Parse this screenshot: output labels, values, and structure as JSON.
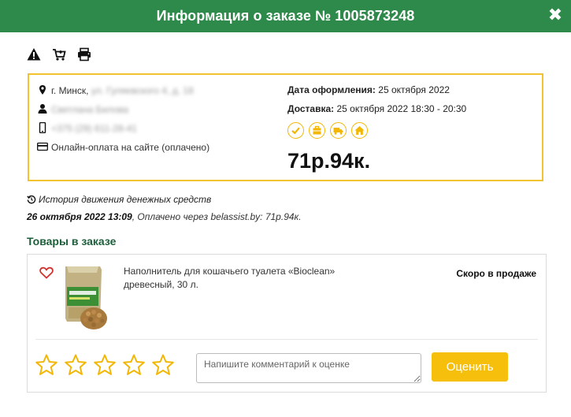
{
  "header": {
    "title": "Информация о заказе № 1005873248",
    "close_icon": "close-icon"
  },
  "toolbar": {
    "icons": [
      "warning-icon",
      "cart-icon",
      "print-icon"
    ]
  },
  "order": {
    "city": "г. Минск,",
    "street": "ул. Гуляевского 4, д. 18",
    "customer_name": "Светлана Билова",
    "phone": "+375 (29) 611-28-41",
    "payment": "Онлайн-оплата на сайте (оплачено)",
    "date_label": "Дата оформления:",
    "date_value": "25 октября 2022",
    "delivery_label": "Доставка:",
    "delivery_value": "25 октября 2022 18:30 - 20:30",
    "status_icons": [
      "check-icon",
      "box-icon",
      "truck-icon",
      "home-icon"
    ],
    "total": "71р.94к.",
    "accent_color": "#f2b705"
  },
  "history": {
    "title": "История движения денежных средств",
    "entry_date": "26 октября 2022 13:09",
    "entry_text": ", Оплачено через belassist.by: 71р.94к."
  },
  "goods": {
    "title": "Товары в заказе",
    "product_name": "Наполнитель для кошачьего туалета «Bioclean» древесный, 30 л.",
    "product_status": "Скоро в продаже",
    "comment_placeholder": "Напишите комментарий к оценке",
    "rate_label": "Оценить",
    "stars_count": 5
  }
}
